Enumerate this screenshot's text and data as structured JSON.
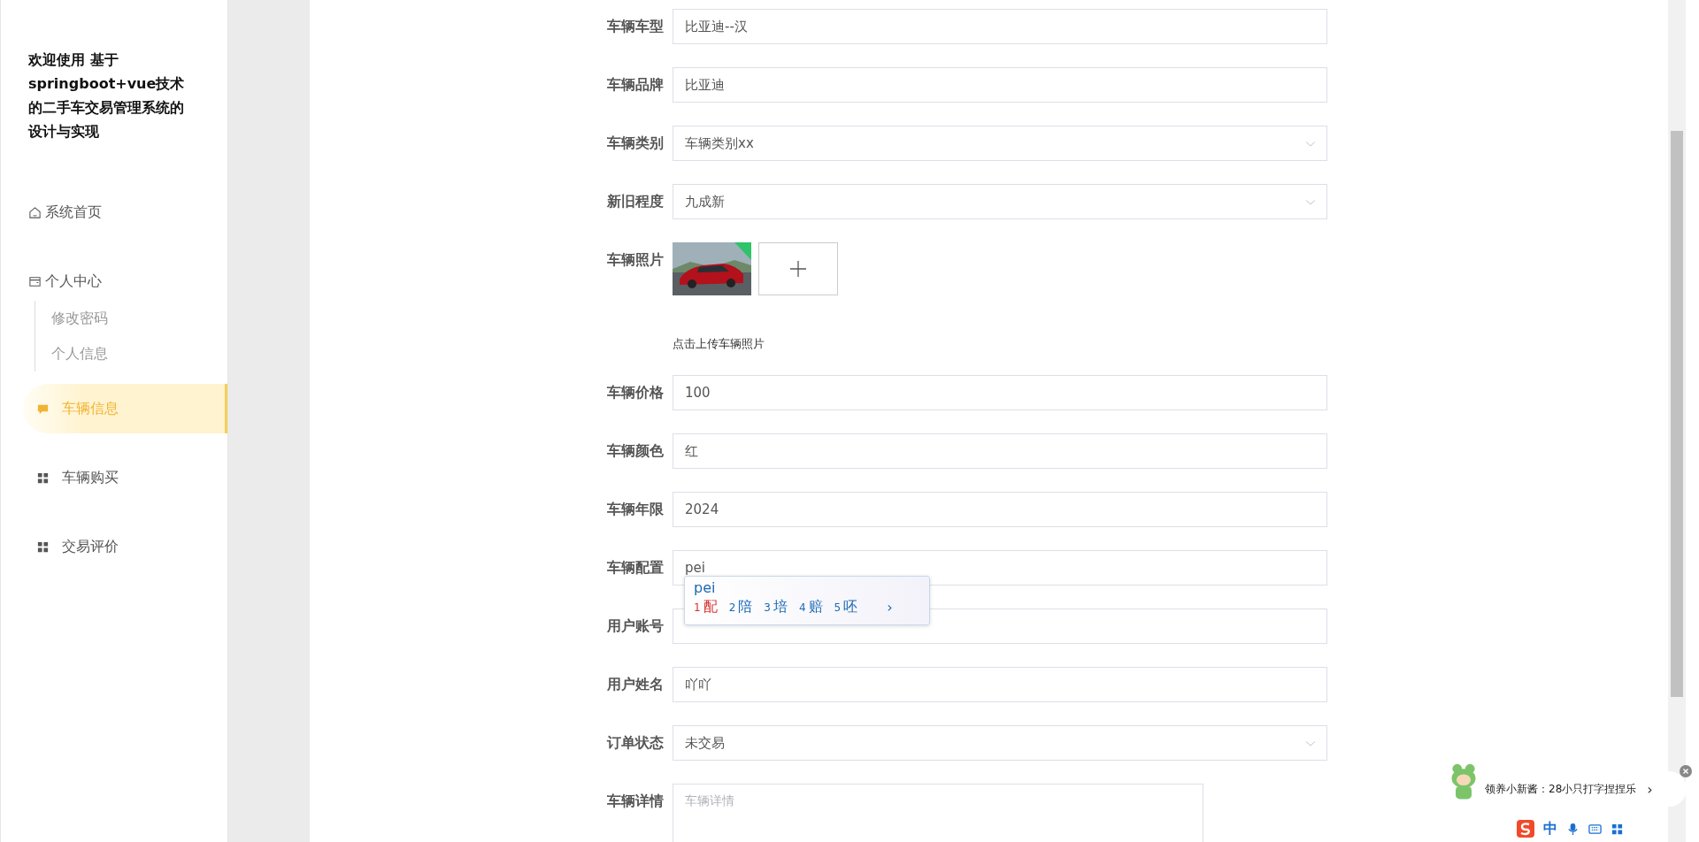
{
  "sidebar": {
    "title": "欢迎使用 基于springboot+vue技术的二手车交易管理系统的设计与实现",
    "items": [
      {
        "label": "系统首页",
        "kind": "home",
        "selected": false
      },
      {
        "label": "个人中心",
        "kind": "card",
        "selected": false,
        "children": [
          {
            "label": "修改密码",
            "selected": false
          },
          {
            "label": "个人信息",
            "selected": false
          }
        ]
      },
      {
        "label": "车辆信息",
        "kind": "chat",
        "selected": true
      },
      {
        "label": "车辆购买",
        "kind": "grid",
        "selected": false
      },
      {
        "label": "交易评价",
        "kind": "grid",
        "selected": false
      }
    ]
  },
  "form": {
    "fields": [
      {
        "label": "车辆车型",
        "kind": "text",
        "value": "比亚迪--汉"
      },
      {
        "label": "车辆品牌",
        "kind": "text",
        "value": "比亚迪"
      },
      {
        "label": "车辆类别",
        "kind": "select",
        "value": "车辆类别xx"
      },
      {
        "label": "新旧程度",
        "kind": "select",
        "value": "九成新"
      },
      {
        "label": "车辆照片",
        "kind": "upload",
        "hint": "点击上传车辆照片"
      },
      {
        "label": "车辆价格",
        "kind": "text",
        "value": "100"
      },
      {
        "label": "车辆颜色",
        "kind": "text",
        "value": "红"
      },
      {
        "label": "车辆年限",
        "kind": "text",
        "value": "2024"
      },
      {
        "label": "车辆配置",
        "kind": "text",
        "value": "pei",
        "ime": true
      },
      {
        "label": "用户账号",
        "kind": "text"
      },
      {
        "label": "用户姓名",
        "kind": "text",
        "value": "吖吖"
      },
      {
        "label": "订单状态",
        "kind": "select",
        "value": "未交易"
      },
      {
        "label": "车辆详情",
        "kind": "textarea",
        "placeholder": "车辆详情"
      }
    ]
  },
  "ime": {
    "composition": "pei",
    "candidates": [
      {
        "index": "1",
        "text": "配",
        "selected": true
      },
      {
        "index": "2",
        "text": "陪",
        "selected": false
      },
      {
        "index": "3",
        "text": "培",
        "selected": false
      },
      {
        "index": "4",
        "text": "赔",
        "selected": false
      },
      {
        "index": "5",
        "text": "呸",
        "selected": false
      }
    ],
    "next": "›",
    "notification": "领养小新酱：28小只打字捏捏乐",
    "notification_arrow": "›",
    "toolbar_mode": "中"
  }
}
